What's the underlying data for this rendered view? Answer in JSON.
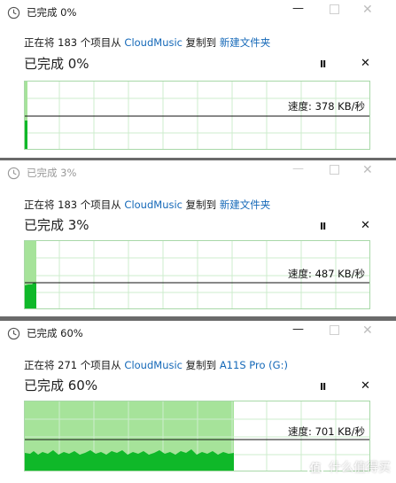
{
  "dialogs": [
    {
      "title": "已完成 0%",
      "desc_prefix": "正在将 183 个项目从 ",
      "source": "CloudMusic",
      "desc_middle": " 复制到 ",
      "destination": "新建文件夹",
      "headline": "已完成 0%",
      "speed": "速度: 378 KB/秒",
      "progress_percent": 0,
      "active": true
    },
    {
      "title": "已完成 3%",
      "desc_prefix": "正在将 183 个项目从 ",
      "source": "CloudMusic",
      "desc_middle": " 复制到 ",
      "destination": "新建文件夹",
      "headline": "已完成 3%",
      "speed": "速度: 487 KB/秒",
      "progress_percent": 3,
      "active": false
    },
    {
      "title": "已完成 60%",
      "desc_prefix": "正在将 271 个项目从 ",
      "source": "CloudMusic",
      "desc_middle": " 复制到 ",
      "destination": "A11S Pro (G:)",
      "headline": "已完成 60%",
      "speed": "速度: 701 KB/秒",
      "progress_percent": 60,
      "active": true
    }
  ],
  "controls": {
    "minimize_glyph": "—",
    "close_glyph": "✕",
    "pause_glyph": "II",
    "cancel_glyph": "✕"
  },
  "watermark": {
    "badge": "值",
    "text": "什么值得买"
  },
  "colors": {
    "link": "#1468b8",
    "graph_fill_light": "#a6e39a",
    "graph_fill_dark": "#0fb829",
    "graph_grid": "#a8d8a8"
  }
}
